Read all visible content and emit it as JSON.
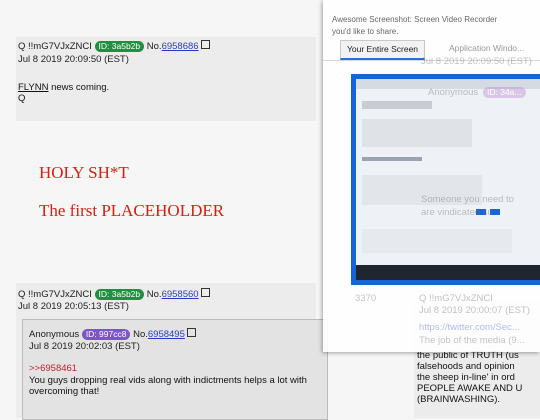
{
  "post1": {
    "name": "Q",
    "trip": "!!mG7VJxZNCI",
    "id_label": "ID: 3a5b2b",
    "no_label": "No.",
    "no": "6958686",
    "date": "Jul 8 2019 20:09:50 (EST)",
    "body_link": "FLYNN",
    "body_rest": " news coming.",
    "sign": "Q"
  },
  "image_text": {
    "line1": "HOLY SH*T",
    "line2": "The first PLACEHOLDER"
  },
  "post2": {
    "name": "Q",
    "trip": "!!mG7VJxZNCI",
    "id_label": "ID: 3a5b2b",
    "no_label": "No.",
    "no": "6958560",
    "date": "Jul 8 2019 20:05:13 (EST)"
  },
  "quoted": {
    "name": "Anonymous",
    "id_label": "ID: 997cc8",
    "no_label": "No.",
    "no": "6958495",
    "date": "Jul 8 2019 20:02:03 (EST)",
    "reply_link": ">>6958461",
    "body": "You guys dropping real vids along with indictments helps a lot with overcoming that!"
  },
  "right_post": {
    "lines": [
      "the public of TRUTH (us",
      "falsehoods and opinion",
      "the sheep in-line' in ord",
      "PEOPLE AWAKE AND U",
      "(BRAINWASHING)."
    ]
  },
  "dialog": {
    "title_line1": "Awesome Screenshot: Screen Video Recorder",
    "title_line2": "you'd like to share.",
    "tab_active": "Your Entire Screen",
    "tab_inactive": "Application Windo..."
  },
  "ghost": {
    "date": "Jul 8 2019 20:09:50 (EST)",
    "anon": "Anonymous",
    "anon_id": "ID: 34a...",
    "line1": "Someone you need to",
    "line2": "are vindicated su...",
    "count": "3370",
    "trip": "Q !!mG7VJxZNCI",
    "date2": "Jul 8 2019 20:00:07 (EST)",
    "url": "https://twitter.com/Sec...",
    "job": "The job of the media (9..."
  },
  "colors": {
    "id_green": "#1e9140",
    "id_purple": "#7b55c9",
    "link_blue": "#2a3cc4",
    "reply_red": "#c0202a",
    "big_red": "#d6200d",
    "thumb_blue": "#1565d8"
  }
}
